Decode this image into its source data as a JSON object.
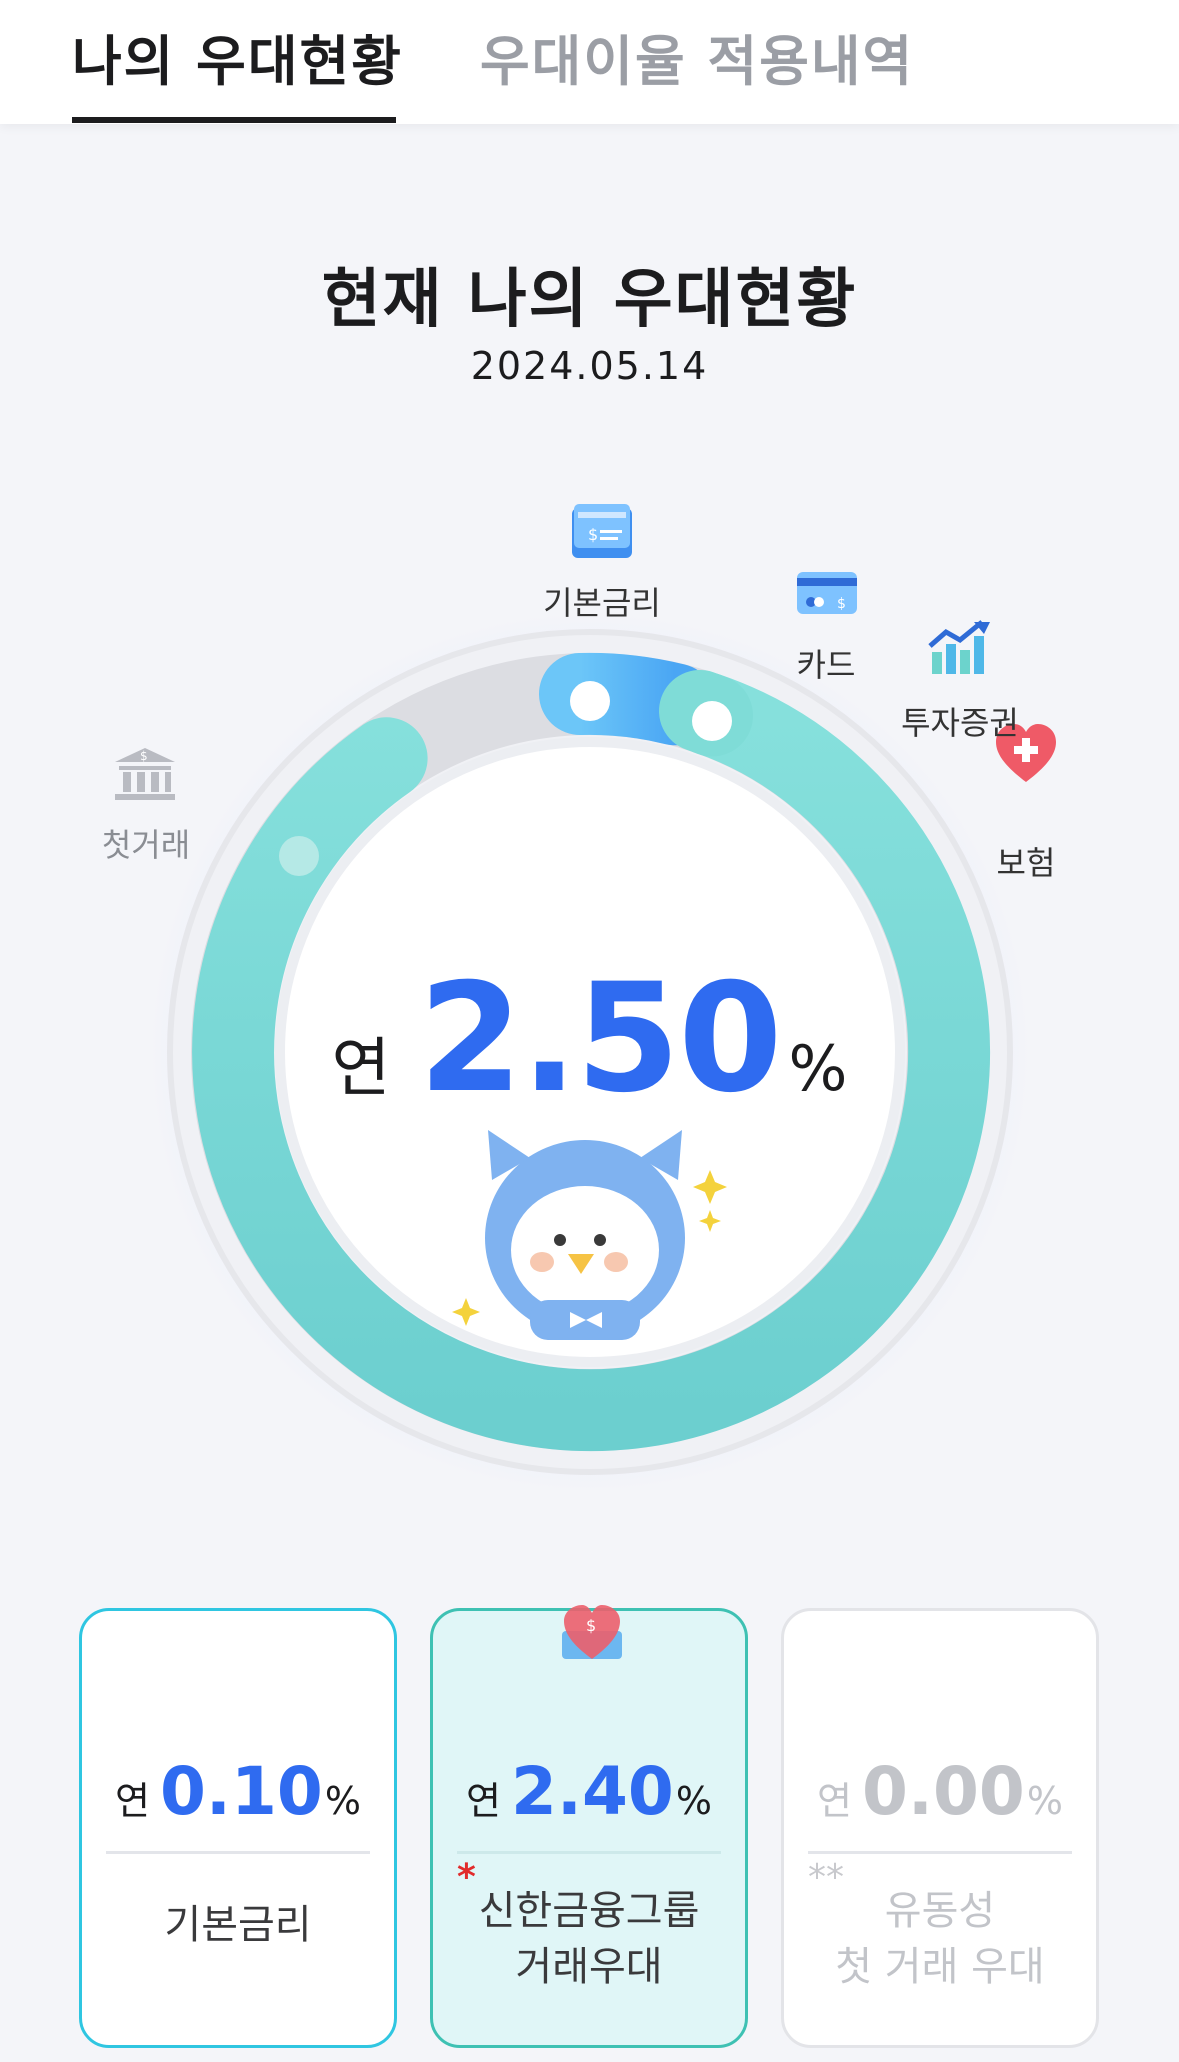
{
  "tabs": {
    "active": "나의 우대현황",
    "inactive": "우대이율 적용내역"
  },
  "status": {
    "title": "현재 나의 우대현황",
    "date": "2024.05.14"
  },
  "gauge": {
    "categories": {
      "base": "기본금리",
      "card": "카드",
      "invest": "투자증권",
      "insurance": "보험",
      "first": "첫거래"
    },
    "rate_prefix": "연",
    "rate_value": "2.50",
    "rate_unit": "%",
    "track_color": "#dcdde2",
    "progress_color": "#7dd8d6",
    "base_color": "#5ab8f5"
  },
  "cards": [
    {
      "prefix": "연",
      "value": "0.10",
      "unit": "%",
      "label": "기본금리",
      "note": ""
    },
    {
      "prefix": "연",
      "value": "2.40",
      "unit": "%",
      "label_line1": "신한금융그룹",
      "label_line2": "거래우대",
      "note": "*"
    },
    {
      "prefix": "연",
      "value": "0.00",
      "unit": "%",
      "label_line1": "유동성",
      "label_line2": "첫 거래 우대",
      "note": "**"
    }
  ],
  "colors": {
    "accent_blue": "#2f6bf0",
    "teal": "#7dd8d6"
  }
}
